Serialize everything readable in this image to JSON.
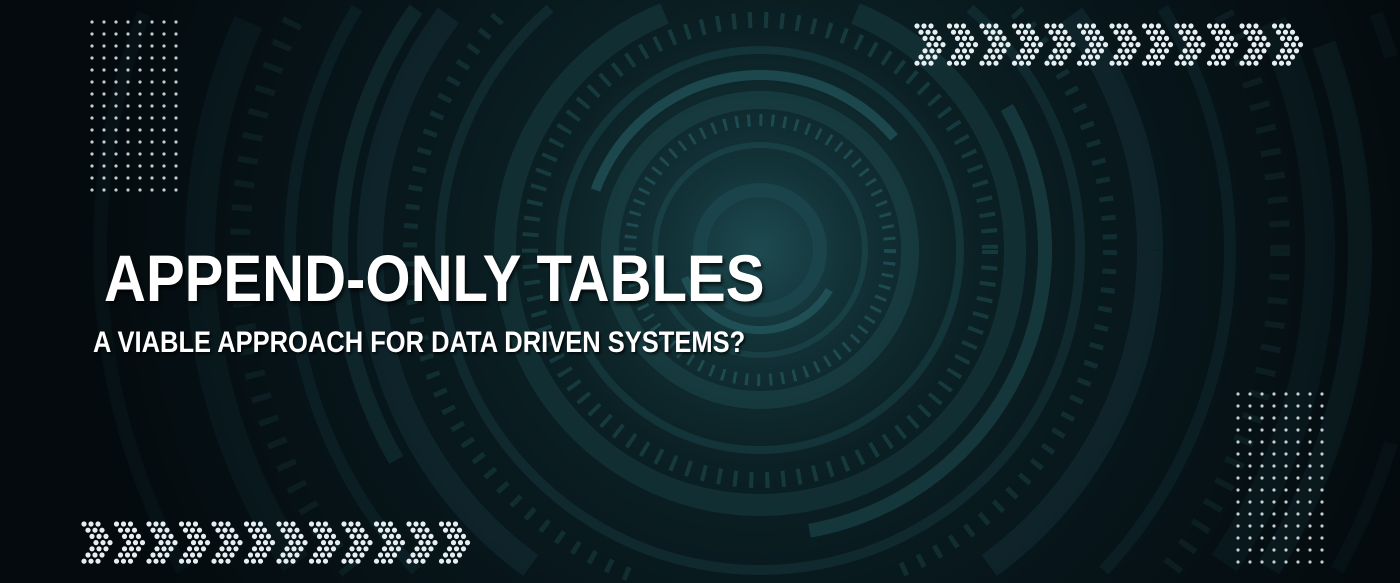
{
  "banner": {
    "title": "APPEND-ONLY TABLES",
    "subtitle": "A VIABLE APPROACH FOR DATA DRIVEN SYSTEMS?"
  },
  "colors": {
    "background": "#050b0e",
    "ring": "#1f4d53",
    "accent": "#2c6a70",
    "text": "#ffffff",
    "dots": "#e6eef2"
  },
  "decor": {
    "chevron_rows": [
      {
        "name": "top-right-chevrons",
        "count": 12
      },
      {
        "name": "bottom-left-chevrons",
        "count": 12
      }
    ],
    "dot_grids": [
      {
        "name": "top-left-dot-grid",
        "columns": 8,
        "rows": 15
      },
      {
        "name": "bottom-right-dot-grid",
        "columns": 8,
        "rows": 15
      }
    ]
  }
}
